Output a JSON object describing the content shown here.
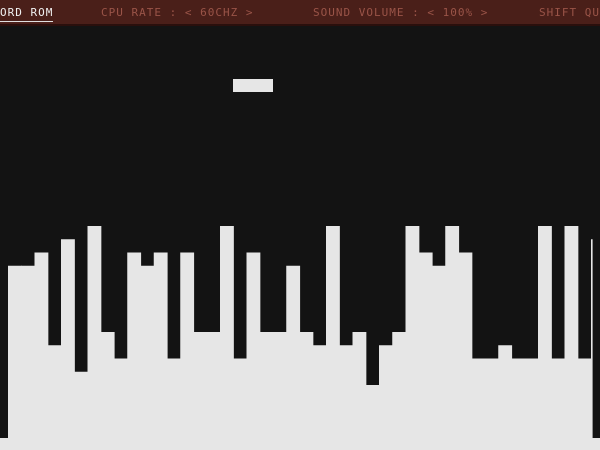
{
  "topbar": {
    "rom_label": "ORD ROM",
    "cpu_rate": "CPU RATE : <  60CHZ  >",
    "sound_volume": "SOUND VOLUME : <  100%  >",
    "shift_label": "SHIFT QU"
  },
  "colors": {
    "topbar_bg": "#4a1f19",
    "topbar_text": "#9a5448",
    "screen_bg": "#131313",
    "pixel_fg": "#e6e6e6"
  },
  "game": {
    "skyline_heights": [
      13,
      13,
      14,
      7,
      15,
      5,
      16,
      8,
      6,
      14,
      13,
      14,
      6,
      14,
      8,
      8,
      16,
      6,
      14,
      8,
      8,
      13,
      8,
      7,
      16,
      7,
      8,
      4,
      7,
      8,
      16,
      14,
      13,
      16,
      14,
      6,
      6,
      7,
      6,
      6,
      16,
      6,
      16,
      6,
      15,
      14,
      13,
      13,
      15,
      7
    ]
  }
}
